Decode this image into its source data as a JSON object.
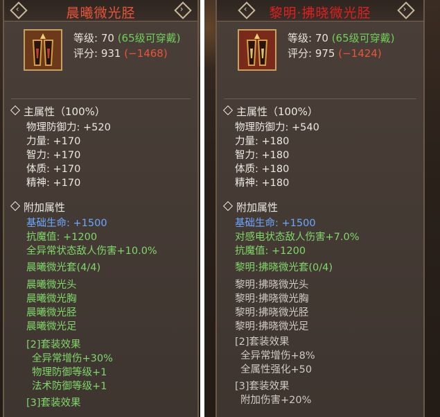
{
  "left": {
    "title": "晨曦微光胫",
    "title_color": "#e8553a",
    "level_label": "等级: 70",
    "wear_note": "(65级可穿戴)",
    "score_label": "评分: 931",
    "score_diff": "(−1468)",
    "main_header": "主属性（100%）",
    "main_stats": [
      "物理防御力: +520",
      "力量: +170",
      "智力: +170",
      "体质: +170",
      "精神: +170"
    ],
    "extra_header": "附加属性",
    "extra_blue": "基础生命: +1500",
    "extra_green": [
      "抗魔值: +1200",
      "全异常状态敌人伤害+10.0%"
    ],
    "set_name": "晨曦微光套(4/4)",
    "set_pieces": [
      "晨曦微光头",
      "晨曦微光胸",
      "晨曦微光胫",
      "晨曦微光足"
    ],
    "effect2_header": "[2]套装效果",
    "effect2_lines": [
      "全异常增伤+30%",
      "物理防御等级+1",
      "法术防御等级+1"
    ],
    "effect3_header": "[3]套装效果"
  },
  "right": {
    "title": "黎明·拂晓微光胫",
    "title_color": "#e02020",
    "level_label": "等级: 70",
    "wear_note": "(65级可穿戴)",
    "score_label": "评分: 975",
    "score_diff": "(−1424)",
    "main_header": "主属性（100%）",
    "main_stats": [
      "物理防御力: +540",
      "力量: +180",
      "智力: +180",
      "体质: +180",
      "精神: +180"
    ],
    "extra_header": "附加属性",
    "extra_blue": "基础生命: +1500",
    "extra_green": [
      "对感电状态敌人伤害+7.0%",
      "抗魔值: +1200"
    ],
    "set_name": "黎明:拂晓微光套(0/4)",
    "set_pieces": [
      "黎明:拂晓微光头",
      "黎明:拂晓微光胸",
      "黎明:拂晓微光胫",
      "黎明:拂晓微光足"
    ],
    "effect2_header": "[2]套装效果",
    "effect2_lines": [
      "全异常增伤+8%",
      "全属性强化+50"
    ],
    "effect3_header": "[3]套装效果",
    "effect3_lines": [
      "附加伤害+20%"
    ]
  },
  "nav_icons": [
    "diamond-left-arrow-icon",
    "diamond-right-arrow-icon"
  ],
  "colors": {
    "green": "#6fd05a",
    "red": "#e8553a",
    "blue": "#6aa8ff",
    "frame": "#c8a060"
  }
}
